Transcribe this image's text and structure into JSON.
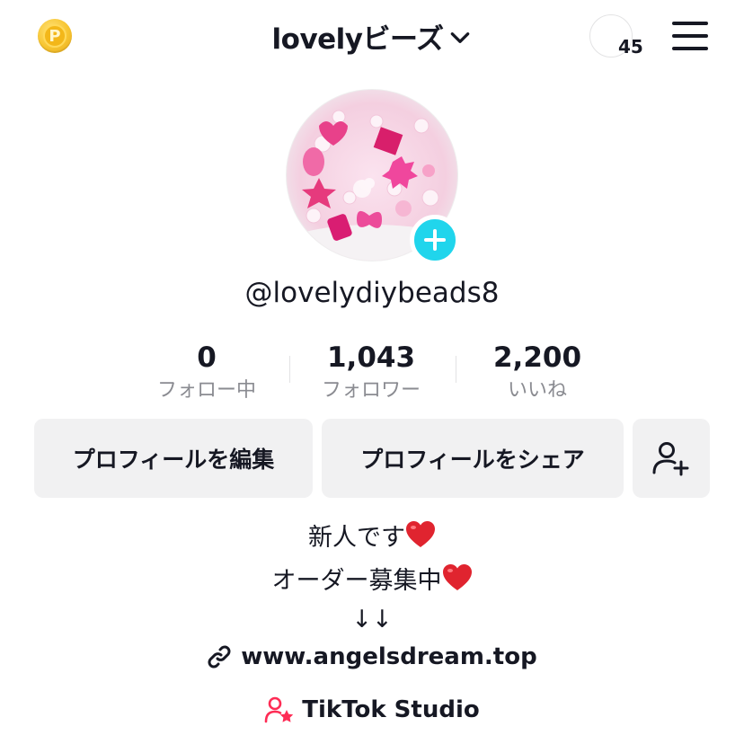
{
  "header": {
    "coin_symbol": "P",
    "title": "lovelyビーズ",
    "story_count": "45"
  },
  "profile": {
    "username": "@lovelydiybeads8",
    "stats": [
      {
        "value": "0",
        "label": "フォロー中"
      },
      {
        "value": "1,043",
        "label": "フォロワー"
      },
      {
        "value": "2,200",
        "label": "いいね"
      }
    ]
  },
  "actions": {
    "edit_profile": "プロフィールを編集",
    "share_profile": "プロフィールをシェア"
  },
  "bio": {
    "line1": "新人です",
    "line2": "オーダー募集中",
    "line3": "↓↓",
    "link": "www.angelsdream.top",
    "studio": "TikTok Studio"
  },
  "colors": {
    "accent_cyan": "#20d5ec",
    "heart_red": "#e0242f",
    "studio_pink": "#fe2c55",
    "button_bg": "#f1f1f2",
    "muted_text": "#8a8b91"
  },
  "icons": [
    "coin-icon",
    "chevron-down-icon",
    "menu-icon",
    "plus-icon",
    "add-friend-icon",
    "heart-icon",
    "link-icon",
    "studio-icon"
  ]
}
